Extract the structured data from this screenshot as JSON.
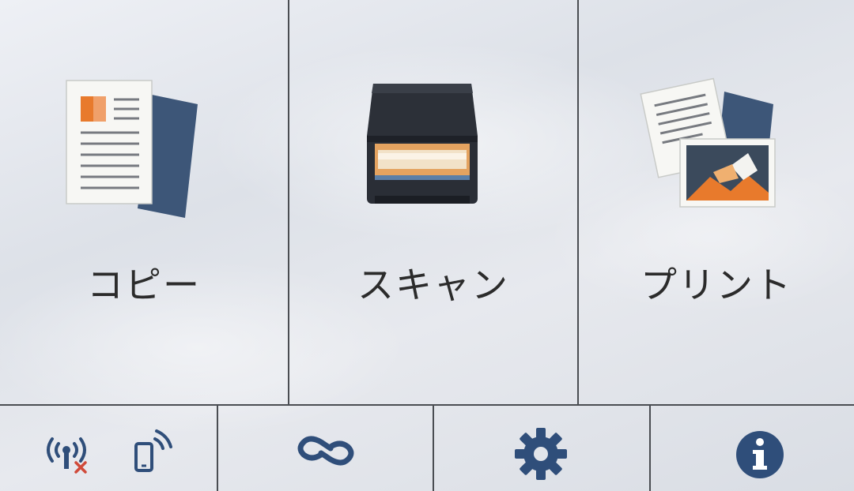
{
  "tiles": [
    {
      "id": "copy",
      "label": "コピー",
      "icon": "copy-document-icon"
    },
    {
      "id": "scan",
      "label": "スキャン",
      "icon": "scanner-icon"
    },
    {
      "id": "print",
      "label": "プリント",
      "icon": "print-document-photo-icon"
    }
  ],
  "bottom_bar": {
    "items": [
      {
        "id": "network-status",
        "icons": [
          "wifi-disconnected-icon",
          "mobile-wireless-icon"
        ]
      },
      {
        "id": "connect",
        "icon": "link-icon"
      },
      {
        "id": "settings",
        "icon": "gear-icon"
      },
      {
        "id": "info",
        "icon": "info-icon"
      }
    ]
  },
  "colors": {
    "accent_blue": "#2f4e7a",
    "document_orange": "#e87a2c",
    "scanner_dark": "#2c3038",
    "wifi_error_red": "#d04a3a",
    "divider": "#4a4d52"
  }
}
